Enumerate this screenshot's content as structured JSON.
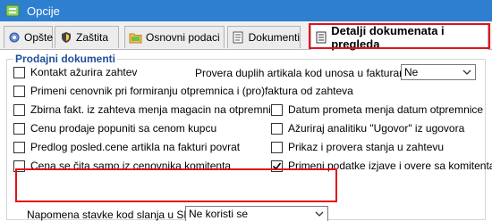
{
  "window": {
    "title": "Opcije"
  },
  "tabs": [
    {
      "label": "Opšte",
      "icon": "gear-icon"
    },
    {
      "label": "Zaštita",
      "icon": "shield-icon"
    },
    {
      "label": "Osnovni podaci",
      "icon": "folder-icon"
    },
    {
      "label": "Dokumenti",
      "icon": "document-icon"
    },
    {
      "label": "Detalji dokumenata i pregleda",
      "icon": "document-details-icon",
      "active": true
    }
  ],
  "group": {
    "title": "Prodajni dokumenti"
  },
  "left_options": [
    {
      "label": "Kontakt ažurira zahtev",
      "checked": false
    },
    {
      "label": "Primeni cenovnik pri formiranju otpremnica i (pro)faktura od zahteva",
      "checked": false
    },
    {
      "label": "Zbirna fakt. iz zahteva menja magacin na otpremnici",
      "checked": false
    },
    {
      "label": "Cenu prodaje popuniti sa cenom kupcu",
      "checked": false
    },
    {
      "label": "Predlog posled.cene artikla na fakturi povrat",
      "checked": false
    },
    {
      "label": "Cena se čita samo iz cenovnika komitenta",
      "checked": false
    }
  ],
  "duplicate_check": {
    "label": "Provera duplih artikala kod unosa u fakturama:",
    "value": "Ne"
  },
  "right_options": [
    {
      "label": "Datum prometa menja datum otpremnice",
      "checked": false
    },
    {
      "label": "Ažuriraj analitiku \"Ugovor\" iz ugovora",
      "checked": false
    },
    {
      "label": "Prikaz i provera stanja u zahtevu",
      "checked": false
    },
    {
      "label": "Primeni podatke izjave i overe sa komitenta",
      "checked": true
    }
  ],
  "sef_note": {
    "label": "Napomena stavke kod slanja u SEF:",
    "value": "Ne koristi se"
  },
  "colors": {
    "titlebar": "#2f7fd0",
    "highlight": "#e0121c",
    "group_title": "#1f4e9a"
  }
}
